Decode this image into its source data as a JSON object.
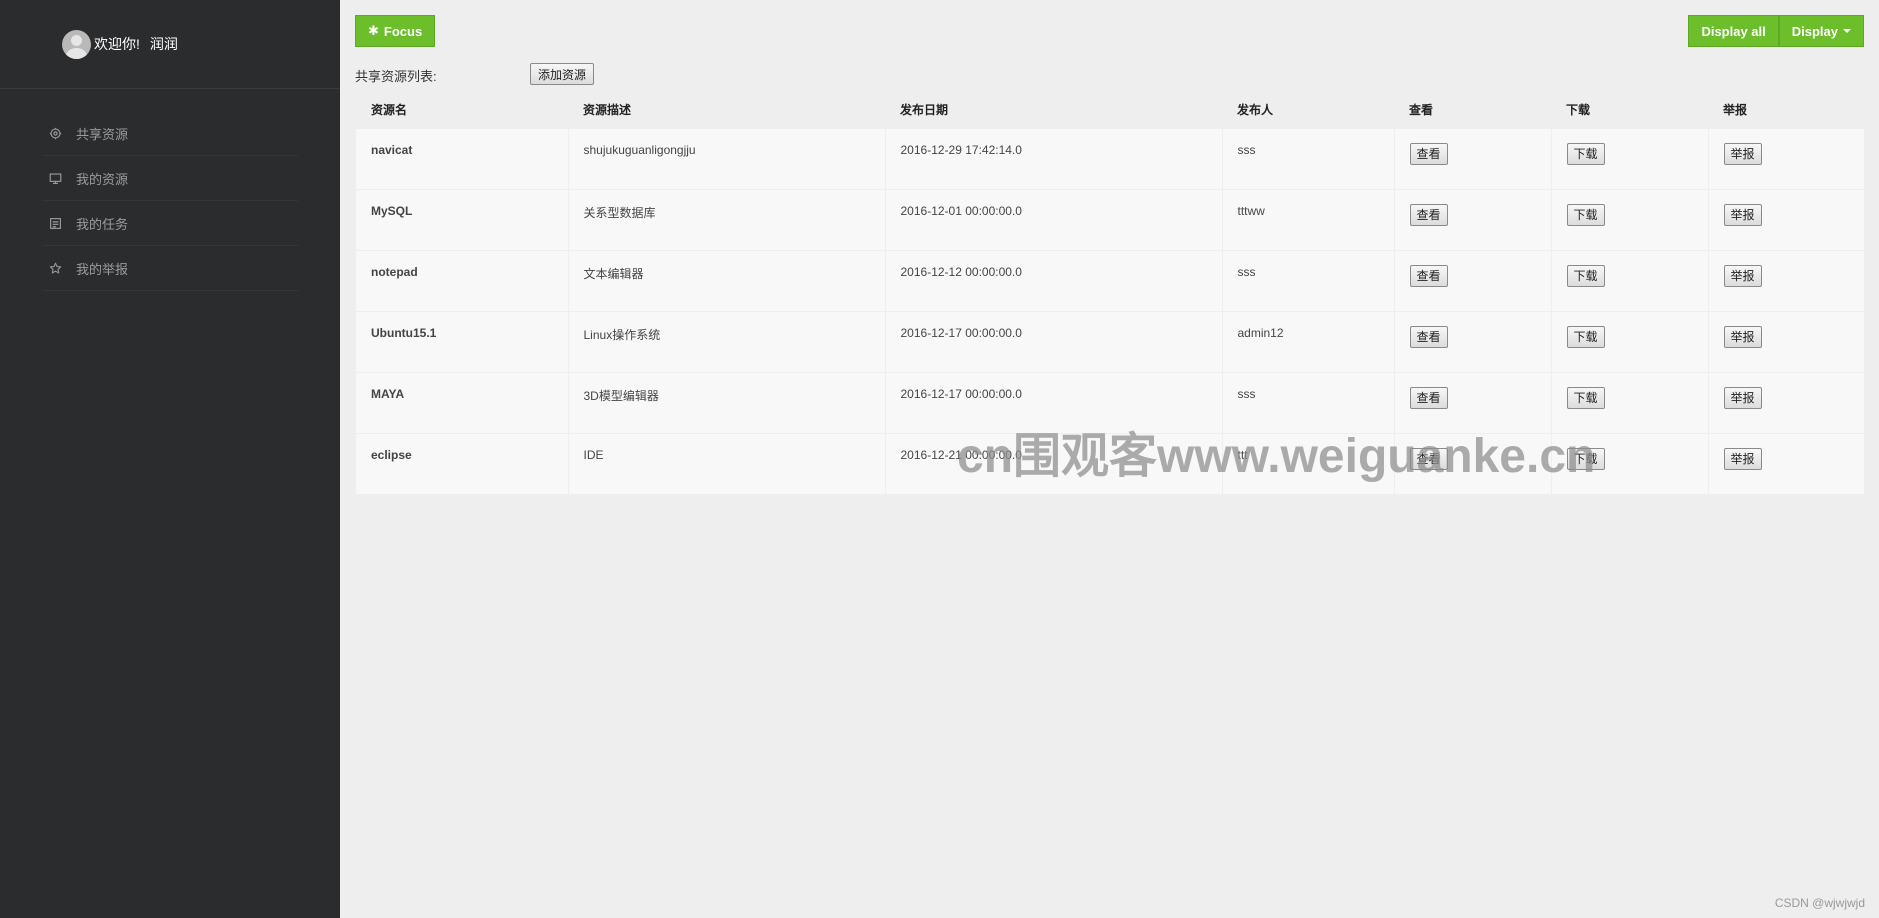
{
  "sidebar": {
    "welcome": "欢迎你!",
    "username": "润润",
    "items": [
      {
        "label": "共享资源",
        "icon": "settings-icon"
      },
      {
        "label": "我的资源",
        "icon": "monitor-icon"
      },
      {
        "label": "我的任务",
        "icon": "task-icon"
      },
      {
        "label": "我的举报",
        "icon": "star-icon"
      }
    ]
  },
  "toolbar": {
    "focus_label": "Focus",
    "display_all_label": "Display all",
    "display_label": "Display"
  },
  "list": {
    "label": "共享资源列表:",
    "add_button": "添加资源"
  },
  "table": {
    "headers": [
      "资源名",
      "资源描述",
      "发布日期",
      "发布人",
      "查看",
      "下载",
      "举报"
    ],
    "view_label": "查看",
    "download_label": "下载",
    "report_label": "举报",
    "rows": [
      {
        "name": "navicat",
        "desc": "shujukuguanligongjju",
        "date": "2016-12-29 17:42:14.0",
        "publisher": "sss"
      },
      {
        "name": "MySQL",
        "desc": "关系型数据库",
        "date": "2016-12-01 00:00:00.0",
        "publisher": "tttww"
      },
      {
        "name": "notepad",
        "desc": "文本编辑器",
        "date": "2016-12-12 00:00:00.0",
        "publisher": "sss"
      },
      {
        "name": "Ubuntu15.1",
        "desc": "Linux操作系统",
        "date": "2016-12-17 00:00:00.0",
        "publisher": "admin12"
      },
      {
        "name": "MAYA",
        "desc": "3D模型编辑器",
        "date": "2016-12-17 00:00:00.0",
        "publisher": "sss"
      },
      {
        "name": "eclipse",
        "desc": "IDE",
        "date": "2016-12-21 00:00:00.0",
        "publisher": "ttt"
      }
    ]
  },
  "watermark": "cn围观客www.weiguanke.cn",
  "credit": "CSDN @wjwjwjd"
}
